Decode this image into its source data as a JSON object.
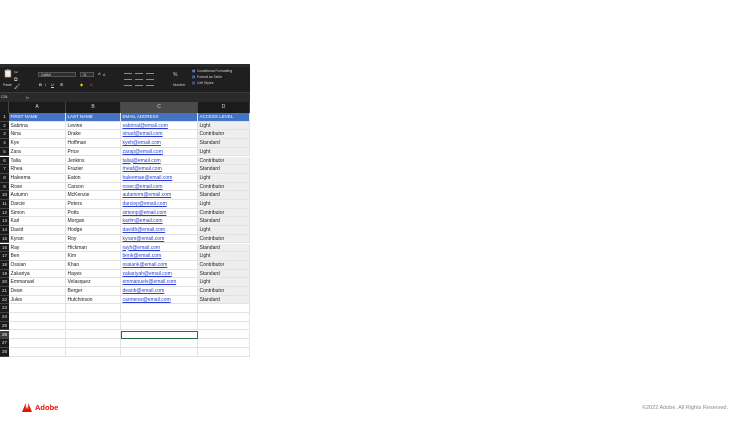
{
  "ribbon": {
    "paste_label": "Paste",
    "font_name": "Calibri",
    "font_size": "11",
    "number_label": "Number",
    "conditional_formatting": "Conditional Formatting",
    "format_as_table": "Format as Table",
    "cell_styles": "Cell Styles"
  },
  "formula_bar": {
    "name_box": "C26",
    "fx_label": "fx"
  },
  "columns": [
    "A",
    "B",
    "C",
    "D"
  ],
  "selected_column": "C",
  "active_cell": "C26",
  "header_row": [
    "FIRST NAME",
    "LAST NAME",
    "EMAIL ADDRESS",
    "ACCESS LEVEL"
  ],
  "rows": [
    [
      "Sabrina",
      "Levine",
      "sabrinal@email.com",
      "Light"
    ],
    [
      "Nina",
      "Drake",
      "ninad@email.com",
      "Contributor"
    ],
    [
      "Kye",
      "Hoffman",
      "kyeh@email.com",
      "Standard"
    ],
    [
      "Zara",
      "Price",
      "zarap@email.com",
      "Light"
    ],
    [
      "Talia",
      "Jenkins",
      "taliaj@email.com",
      "Contributor"
    ],
    [
      "Rhea",
      "Frazier",
      "rheaf@email.com",
      "Standard"
    ],
    [
      "Haleema",
      "Eaton",
      "haleemae@email.com",
      "Light"
    ],
    [
      "Rose",
      "Carson",
      "rosec@email.com",
      "Contributor"
    ],
    [
      "Autumn",
      "McKenzie",
      "autumnm@email.com",
      "Standard"
    ],
    [
      "Darcie",
      "Peters",
      "darciep@email.com",
      "Light"
    ],
    [
      "Simon",
      "Potts",
      "simonp@email.com",
      "Contributor"
    ],
    [
      "Karl",
      "Morgan",
      "karlm@email.com",
      "Standard"
    ],
    [
      "David",
      "Hodge",
      "davidh@email.com",
      "Light"
    ],
    [
      "Kyran",
      "Roy",
      "kyranr@email.com",
      "Contributor"
    ],
    [
      "Ray",
      "Hickman",
      "rayh@email.com",
      "Standard"
    ],
    [
      "Ben",
      "Kim",
      "benk@email.com",
      "Light"
    ],
    [
      "Ossian",
      "Khan",
      "ossiank@email.com",
      "Contributor"
    ],
    [
      "Zakariya",
      "Hayes",
      "zakariyah@email.com",
      "Standard"
    ],
    [
      "Emmanuel",
      "Velasquez",
      "emmanuelv@email.com",
      "Light"
    ],
    [
      "Dean",
      "Berger",
      "deanb@email.com",
      "Contributor"
    ],
    [
      "Jules",
      "Hutchinson",
      "carmenw@email.com",
      "Standard"
    ]
  ],
  "empty_row_numbers": [
    "23",
    "24",
    "25",
    "26",
    "27",
    "28"
  ],
  "footer": {
    "brand": "Adobe",
    "copyright": "©2022 Adobe. All Rights Reserved."
  },
  "colors": {
    "header_fill": "#4472c4",
    "hyperlink": "#2a3fd0",
    "active_cell_border": "#1e7145",
    "adobe_red": "#eb1000"
  }
}
